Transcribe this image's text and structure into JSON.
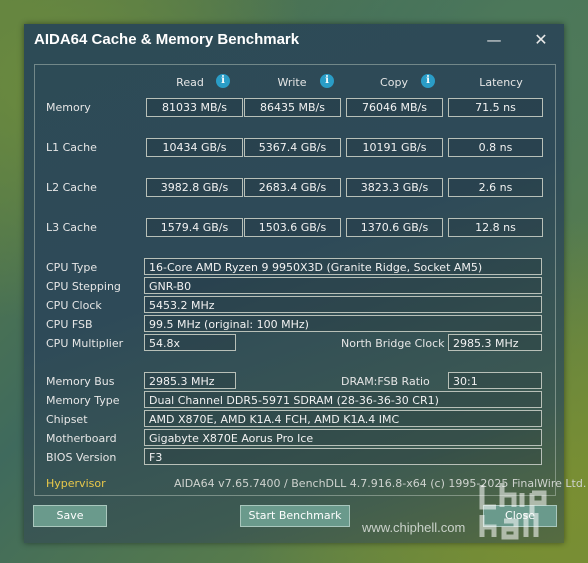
{
  "window": {
    "title": "AIDA64 Cache & Memory Benchmark",
    "minimize_glyph": "—",
    "close_glyph": "✕"
  },
  "columns": {
    "read": "Read",
    "write": "Write",
    "copy": "Copy",
    "latency": "Latency"
  },
  "rows": {
    "memory": {
      "label": "Memory",
      "read": "81033 MB/s",
      "write": "86435 MB/s",
      "copy": "76046 MB/s",
      "latency": "71.5 ns"
    },
    "l1": {
      "label": "L1 Cache",
      "read": "10434 GB/s",
      "write": "5367.4 GB/s",
      "copy": "10191 GB/s",
      "latency": "0.8 ns"
    },
    "l2": {
      "label": "L2 Cache",
      "read": "3982.8 GB/s",
      "write": "2683.4 GB/s",
      "copy": "3823.3 GB/s",
      "latency": "2.6 ns"
    },
    "l3": {
      "label": "L3 Cache",
      "read": "1579.4 GB/s",
      "write": "1503.6 GB/s",
      "copy": "1370.6 GB/s",
      "latency": "12.8 ns"
    }
  },
  "info": {
    "cpu_type_label": "CPU Type",
    "cpu_type": "16-Core AMD Ryzen 9 9950X3D  (Granite Ridge, Socket AM5)",
    "cpu_stepping_label": "CPU Stepping",
    "cpu_stepping": "GNR-B0",
    "cpu_clock_label": "CPU Clock",
    "cpu_clock": "5453.2 MHz",
    "cpu_fsb_label": "CPU FSB",
    "cpu_fsb": "99.5 MHz  (original: 100 MHz)",
    "cpu_mult_label": "CPU Multiplier",
    "cpu_mult": "54.8x",
    "nb_clock_label": "North Bridge Clock",
    "nb_clock": "2985.3 MHz",
    "mem_bus_label": "Memory Bus",
    "mem_bus": "2985.3 MHz",
    "dram_ratio_label": "DRAM:FSB Ratio",
    "dram_ratio": "30:1",
    "mem_type_label": "Memory Type",
    "mem_type": "Dual Channel DDR5-5971 SDRAM  (28-36-36-30 CR1)",
    "chipset_label": "Chipset",
    "chipset": "AMD X870E, AMD K1A.4 FCH, AMD K1A.4 IMC",
    "motherboard_label": "Motherboard",
    "motherboard": "Gigabyte X870E Aorus Pro Ice",
    "bios_label": "BIOS Version",
    "bios": "F3"
  },
  "hypervisor": "Hypervisor",
  "footer": "AIDA64 v7.65.7400 / BenchDLL 4.7.916.8-x64  (c) 1995-2025 FinalWire Ltd.",
  "buttons": {
    "save": "Save",
    "start": "Start Benchmark",
    "close": "Close"
  },
  "watermark": {
    "site": "www.chiphell.com",
    "logo_text": "chip hell"
  },
  "info_icon_glyph": "i"
}
